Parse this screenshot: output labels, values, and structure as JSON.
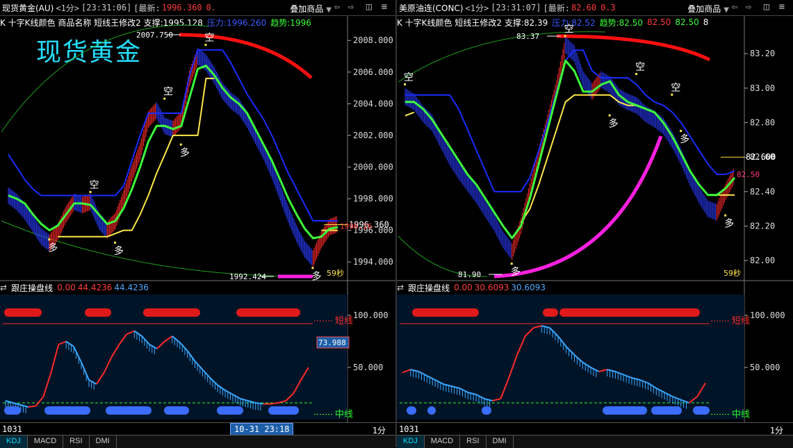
{
  "panes": [
    {
      "title": {
        "name": "现货黄金(AU)",
        "period": "<1分>",
        "time": "[23:31:06]",
        "last_label": "[最新:",
        "last": "1996.360",
        "change": "0."
      },
      "overlay_label": "叠加商品",
      "watermark": "现货黄金",
      "main_indicator": [
        {
          "text": "K 十字K线颜色 商品名称 短线王修改2 支撑:1995.128",
          "color": "#ffffff"
        },
        {
          "text": "压力:1996.260",
          "color": "#3a5bff"
        },
        {
          "text": "趋势:1996",
          "color": "#3cff3c"
        }
      ],
      "sub_indicator": {
        "name": "跟庄操盘线",
        "v1": "0.00",
        "v2": "44.4236",
        "v3": "44.4236"
      },
      "bottom_left": "1031",
      "bottom_right": "1分",
      "time_tag": "10-31 23:18",
      "countdown": "59秒",
      "tabs": [
        "KDJ",
        "MACD",
        "RSI",
        "DMI"
      ]
    },
    {
      "title": {
        "name": "美原油连(CONC)",
        "period": "<1分>",
        "time": "[23:31:07]",
        "last_label": "[最新:",
        "last": "82.60",
        "change": "0.3"
      },
      "overlay_label": "叠加商品",
      "watermark": "",
      "main_indicator": [
        {
          "text": "K 十字K线颜色 短线王修改2 支撑:82.39",
          "color": "#ffffff"
        },
        {
          "text": "压力:82.52",
          "color": "#3a5bff"
        },
        {
          "text": "趋势:82.50",
          "color": "#3cff3c"
        },
        {
          "text": "82.50",
          "color": "#ff3b3b"
        },
        {
          "text": "82.50",
          "color": "#3cff3c"
        },
        {
          "text": "8",
          "color": "#ffffff"
        }
      ],
      "sub_indicator": {
        "name": "跟庄操盘线",
        "v1": "0.00",
        "v2": "30.6093",
        "v3": "30.6093"
      },
      "bottom_left": "1031",
      "bottom_right": "1分",
      "time_tag": "",
      "countdown": "59秒",
      "tabs": [
        "KDJ",
        "MACD",
        "RSI",
        "DMI"
      ]
    }
  ],
  "chart_data": [
    {
      "type": "candlestick",
      "symbol": "现货黄金(AU)",
      "ylim": [
        1993.0,
        2008.8
      ],
      "yticks": [
        "2008.000",
        "2006.000",
        "2004.000",
        "2002.000",
        "2000.000",
        "1998.000",
        "1996.000",
        "1994.000"
      ],
      "last_price_label": "1996.360",
      "pressure_label": "1996.26",
      "high_label": "2007.750",
      "low_label": "1992.424",
      "close_path": [
        1998.2,
        1997.8,
        1997.2,
        1996.4,
        1995.6,
        1995.2,
        1995.9,
        1997.0,
        1997.8,
        1997.6,
        1997.8,
        1996.6,
        1996.0,
        1996.6,
        1998.0,
        1999.6,
        2001.0,
        2003.0,
        2003.6,
        2002.6,
        2002.4,
        2003.0,
        2005.6,
        2007.0,
        2006.6,
        2005.8,
        2004.8,
        2004.2,
        2003.8,
        2003.0,
        2002.0,
        2001.0,
        1999.8,
        1998.4,
        1997.0,
        1995.8,
        1994.8,
        1994.2,
        1995.4,
        1996.2,
        1996.4
      ],
      "trend_line": [
        1998.2,
        1998.0,
        1997.7,
        1997.0,
        1996.4,
        1996.0,
        1996.3,
        1997.0,
        1997.7,
        1997.7,
        1997.6,
        1997.0,
        1996.4,
        1996.6,
        1997.4,
        1998.6,
        2000.0,
        2001.6,
        2002.6,
        2002.6,
        2002.4,
        2002.6,
        2004.4,
        2006.2,
        2006.4,
        2005.8,
        2005.0,
        2004.4,
        2004.0,
        2003.4,
        2002.4,
        2001.4,
        2000.4,
        1999.2,
        1998.0,
        1997.0,
        1996.1,
        1995.5,
        1995.6,
        1996.1,
        1996.2
      ],
      "resistance_line": [
        2000.8,
        2000.0,
        1999.2,
        1998.6,
        1998.2,
        1998.2,
        1998.2,
        1998.2,
        1998.2,
        1998.2,
        1998.2,
        1998.2,
        1998.2,
        1998.2,
        1998.8,
        2000.4,
        2002.0,
        2003.4,
        2003.4,
        2003.4,
        2003.4,
        2003.4,
        2005.8,
        2007.4,
        2007.4,
        2007.4,
        2007.4,
        2006.6,
        2005.6,
        2004.6,
        2003.8,
        2003.0,
        2002.0,
        2000.8,
        1999.6,
        1998.6,
        1997.6,
        1996.6,
        1996.6,
        1996.6,
        1996.6
      ],
      "support_line": [
        null,
        null,
        null,
        null,
        null,
        null,
        1995.6,
        1995.6,
        1995.6,
        1995.6,
        1995.6,
        1995.6,
        1995.6,
        1995.8,
        1996.0,
        1996.0,
        1997.0,
        1998.2,
        1999.6,
        2000.8,
        2002.0,
        2002.0,
        2002.0,
        2002.0,
        2005.6,
        2005.6,
        null,
        null,
        null,
        null,
        null,
        null,
        null,
        null,
        null,
        null,
        null,
        null,
        1996.0,
        1996.0,
        1996.0
      ],
      "sub_chart": {
        "ylim": [
          0,
          120
        ],
        "yticks": [
          "100.000",
          "50.000"
        ],
        "k_values": [
          18,
          16,
          14,
          12,
          13,
          22,
          45,
          72,
          75,
          70,
          55,
          38,
          34,
          45,
          60,
          72,
          82,
          85,
          80,
          72,
          68,
          75,
          80,
          74,
          66,
          56,
          48,
          40,
          33,
          28,
          24,
          20,
          18,
          16,
          15,
          15,
          16,
          18,
          25,
          38,
          50
        ],
        "value_tag": "73.988",
        "top_label": "短线",
        "bottom_label": "中线"
      },
      "signals": [
        {
          "text": "多",
          "x": 5,
          "y": 1995.4
        },
        {
          "text": "空",
          "x": 10,
          "y": 1998.4
        },
        {
          "text": "多",
          "x": 13,
          "y": 1995.2
        },
        {
          "text": "空",
          "x": 19,
          "y": 2004.3
        },
        {
          "text": "多",
          "x": 21,
          "y": 2001.4
        },
        {
          "text": "空",
          "x": 24,
          "y": 2007.7
        },
        {
          "text": "多",
          "x": 37,
          "y": 1993.6
        }
      ]
    },
    {
      "type": "candlestick",
      "symbol": "美原油连(CONC)",
      "ylim": [
        81.9,
        83.35
      ],
      "yticks": [
        "83.20",
        "83.00",
        "82.80",
        "82.60",
        "82.40",
        "82.20",
        "82.00"
      ],
      "last_price_label": "82.600",
      "pressure_label": "82.50",
      "high_label": "83.37",
      "low_label": "81.90",
      "close_path": [
        82.95,
        82.92,
        82.85,
        82.8,
        82.7,
        82.6,
        82.52,
        82.45,
        82.38,
        82.3,
        82.22,
        82.12,
        82.05,
        82.2,
        82.4,
        82.6,
        82.8,
        83.0,
        83.25,
        83.2,
        83.05,
        82.98,
        83.05,
        83.02,
        82.95,
        82.92,
        82.9,
        82.85,
        82.82,
        82.78,
        82.7,
        82.6,
        82.48,
        82.38,
        82.3,
        82.28,
        82.4,
        82.5
      ],
      "trend_line": [
        82.92,
        82.92,
        82.88,
        82.82,
        82.74,
        82.66,
        82.58,
        82.5,
        82.44,
        82.36,
        82.28,
        82.2,
        82.13,
        82.2,
        82.36,
        82.56,
        82.76,
        82.96,
        83.16,
        83.1,
        82.98,
        82.98,
        83.02,
        83.04,
        82.96,
        82.92,
        82.9,
        82.88,
        82.86,
        82.8,
        82.72,
        82.62,
        82.52,
        82.44,
        82.38,
        82.38,
        82.42,
        82.48
      ],
      "resistance_line": [
        82.96,
        82.96,
        82.96,
        82.96,
        82.96,
        82.96,
        82.88,
        82.76,
        82.64,
        82.52,
        82.4,
        82.4,
        82.4,
        82.4,
        82.48,
        82.64,
        82.8,
        82.98,
        83.16,
        83.22,
        83.22,
        83.1,
        83.06,
        83.06,
        83.06,
        83.06,
        83.02,
        82.96,
        82.92,
        82.9,
        82.86,
        82.8,
        82.72,
        82.64,
        82.56,
        82.5,
        82.5,
        82.52
      ],
      "support_line": [
        82.84,
        82.86,
        null,
        null,
        null,
        null,
        null,
        null,
        null,
        null,
        null,
        null,
        null,
        82.22,
        82.3,
        82.44,
        82.6,
        82.76,
        82.92,
        82.96,
        82.96,
        82.96,
        82.96,
        82.96,
        82.92,
        82.9,
        82.9,
        null,
        null,
        null,
        null,
        null,
        null,
        null,
        null,
        82.38,
        82.38,
        82.38
      ],
      "sub_chart": {
        "ylim": [
          0,
          120
        ],
        "yticks": [
          "100.000",
          "50.000"
        ],
        "k_values": [
          45,
          48,
          46,
          42,
          38,
          34,
          32,
          30,
          26,
          24,
          20,
          18,
          20,
          40,
          62,
          80,
          88,
          90,
          88,
          80,
          70,
          62,
          55,
          50,
          46,
          48,
          46,
          43,
          40,
          38,
          35,
          30,
          26,
          22,
          19,
          16,
          22,
          35
        ],
        "value_tag": "",
        "top_label": "短线",
        "bottom_label": "中线"
      },
      "signals": [
        {
          "text": "空",
          "x": 0,
          "y": 83.02
        },
        {
          "text": "多",
          "x": 12,
          "y": 81.98
        },
        {
          "text": "空",
          "x": 18,
          "y": 83.3
        },
        {
          "text": "多",
          "x": 23,
          "y": 82.84
        },
        {
          "text": "空",
          "x": 26,
          "y": 83.08
        },
        {
          "text": "空",
          "x": 30,
          "y": 82.96
        },
        {
          "text": "多",
          "x": 31,
          "y": 82.75
        },
        {
          "text": "多",
          "x": 36,
          "y": 82.26
        }
      ]
    }
  ]
}
